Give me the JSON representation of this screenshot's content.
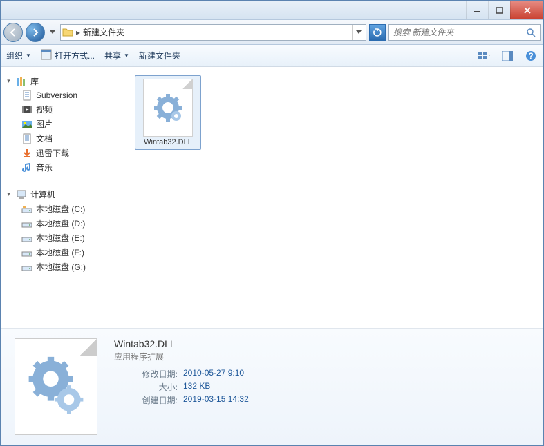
{
  "breadcrumb": {
    "current": "新建文件夹"
  },
  "search": {
    "placeholder": "搜索 新建文件夹"
  },
  "toolbar": {
    "organize": "组织",
    "open_with": "打开方式...",
    "share": "共享",
    "new_folder": "新建文件夹"
  },
  "sidebar": {
    "libraries": {
      "label": "库",
      "items": [
        {
          "label": "Subversion",
          "icon": "doc"
        },
        {
          "label": "视频",
          "icon": "video"
        },
        {
          "label": "图片",
          "icon": "image"
        },
        {
          "label": "文档",
          "icon": "doc"
        },
        {
          "label": "迅雷下载",
          "icon": "download"
        },
        {
          "label": "音乐",
          "icon": "music"
        }
      ]
    },
    "computer": {
      "label": "计算机",
      "items": [
        {
          "label": "本地磁盘 (C:)",
          "icon": "drive-sys"
        },
        {
          "label": "本地磁盘 (D:)",
          "icon": "drive"
        },
        {
          "label": "本地磁盘 (E:)",
          "icon": "drive"
        },
        {
          "label": "本地磁盘 (F:)",
          "icon": "drive"
        },
        {
          "label": "本地磁盘 (G:)",
          "icon": "drive"
        }
      ]
    }
  },
  "files": [
    {
      "name": "Wintab32.DLL"
    }
  ],
  "details": {
    "name": "Wintab32.DLL",
    "type": "应用程序扩展",
    "rows": [
      {
        "label": "修改日期:",
        "value": "2010-05-27 9:10"
      },
      {
        "label": "大小:",
        "value": "132 KB"
      },
      {
        "label": "创建日期:",
        "value": "2019-03-15 14:32"
      }
    ]
  }
}
